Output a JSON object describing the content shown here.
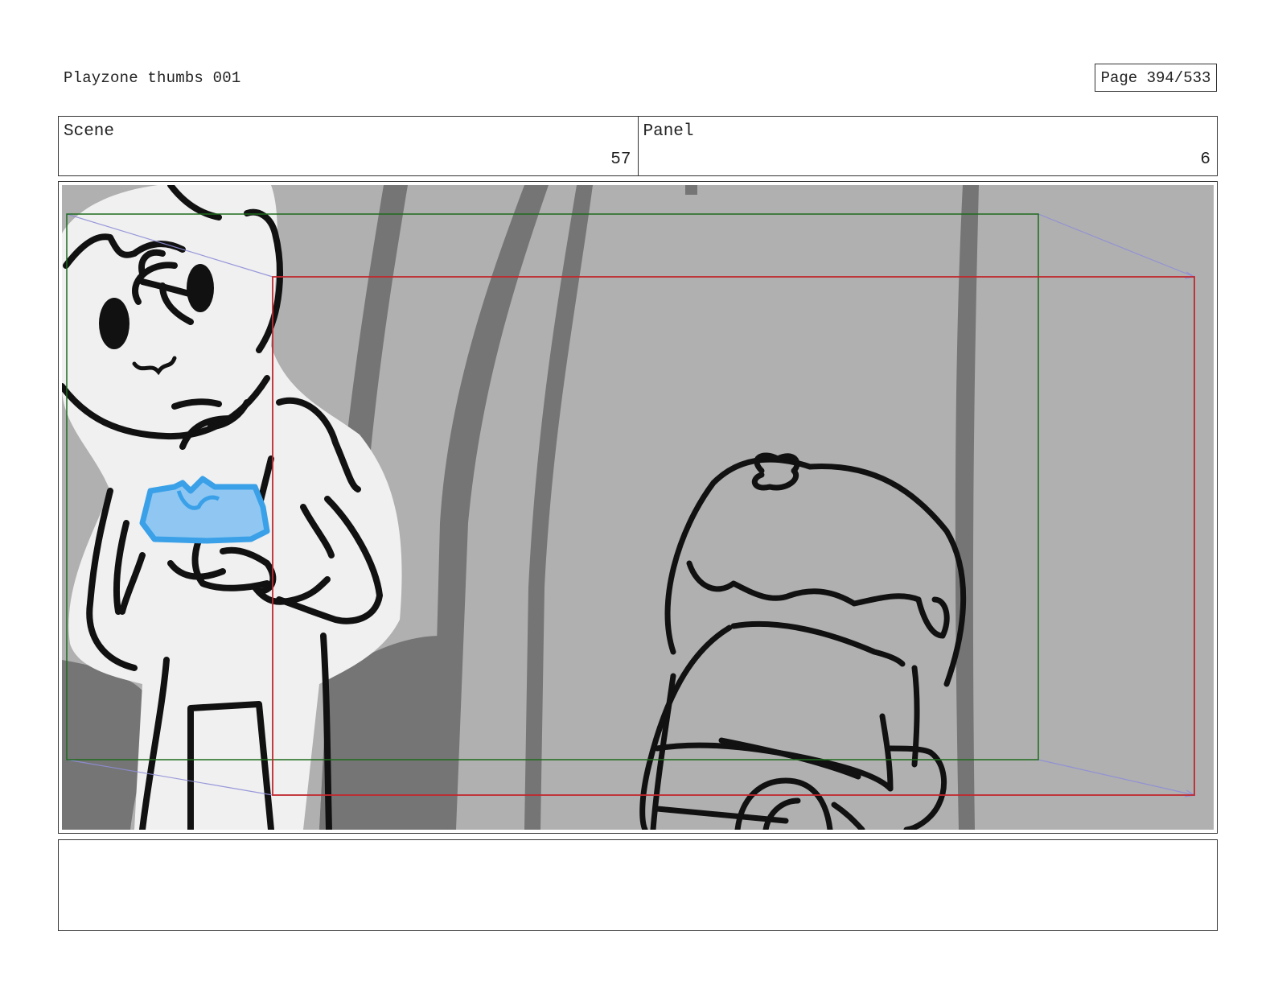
{
  "document": {
    "title": "Playzone thumbs 001",
    "page_label": "Page 394/533"
  },
  "scene": {
    "label": "Scene",
    "value": "57"
  },
  "panel": {
    "label": "Panel",
    "value": "6"
  },
  "frame": {
    "background_color": "#b0b0b0",
    "safe_frame_color": "#1e6b1e",
    "camera_frame_color": "#c0282e",
    "motion_guide_color": "#8e8ed8",
    "held_object_color": "#3aa0e8"
  },
  "notes": {
    "text": ""
  }
}
